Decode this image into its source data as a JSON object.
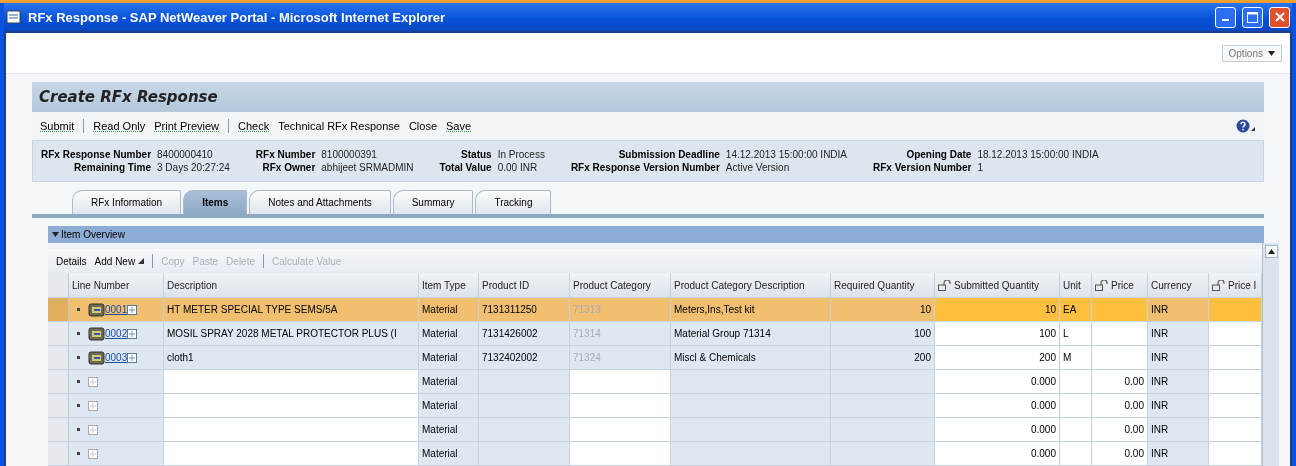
{
  "window": {
    "title": "RFx Response - SAP NetWeaver Portal - Microsoft Internet Explorer"
  },
  "options_button": {
    "label": "Options"
  },
  "page": {
    "title": "Create RFx Response"
  },
  "toolbar": [
    {
      "kind": "link",
      "label": "Submit"
    },
    {
      "kind": "separator"
    },
    {
      "kind": "link",
      "label": "Read Only"
    },
    {
      "kind": "link",
      "label": "Print Preview"
    },
    {
      "kind": "separator"
    },
    {
      "kind": "link",
      "label": "Check"
    },
    {
      "kind": "plain",
      "label": "Technical RFx Response"
    },
    {
      "kind": "plain",
      "label": "Close"
    },
    {
      "kind": "link",
      "label": "Save"
    }
  ],
  "info": [
    [
      {
        "label": "RFx Response Number",
        "value": "8400000410"
      },
      {
        "label": "RFx Number",
        "value": "8100000391"
      },
      {
        "label": "Status",
        "value": "In Process"
      },
      {
        "label": "Submission Deadline",
        "value": "14.12.2013 15:00:00 INDIA"
      },
      {
        "label": "Opening Date",
        "value": "18.12.2013 15:00:00 INDIA"
      }
    ],
    [
      {
        "label": "Remaining Time",
        "value": "3 Days 20:27:24"
      },
      {
        "label": "RFx Owner",
        "value": "abhijeet SRMADMIN"
      },
      {
        "label": "Total Value",
        "value": "0.00 INR"
      },
      {
        "label": "RFx Response Version Number",
        "value": "Active Version"
      },
      {
        "label": "RFx Version Number",
        "value": "1"
      }
    ]
  ],
  "tabs": [
    {
      "label": "RFx Information",
      "selected": false
    },
    {
      "label": "Items",
      "selected": true
    },
    {
      "label": "Notes and Attachments",
      "selected": false
    },
    {
      "label": "Summary",
      "selected": false
    },
    {
      "label": "Tracking",
      "selected": false
    }
  ],
  "section": {
    "title": "Item Overview",
    "expanded": true
  },
  "table_toolbar": [
    {
      "kind": "button",
      "label": "Details",
      "disabled": false
    },
    {
      "kind": "menu",
      "label": "Add New",
      "disabled": false
    },
    {
      "kind": "separator"
    },
    {
      "kind": "button",
      "label": "Copy",
      "disabled": true
    },
    {
      "kind": "button",
      "label": "Paste",
      "disabled": true
    },
    {
      "kind": "button",
      "label": "Delete",
      "disabled": true
    },
    {
      "kind": "separator"
    },
    {
      "kind": "button",
      "label": "Calculate Value",
      "disabled": true
    }
  ],
  "table": {
    "columns": [
      {
        "label": "Line Number",
        "locked": false
      },
      {
        "label": "Description",
        "locked": false
      },
      {
        "label": "Item Type",
        "locked": false
      },
      {
        "label": "Product ID",
        "locked": false
      },
      {
        "label": "Product Category",
        "locked": false
      },
      {
        "label": "Product Category Description",
        "locked": false
      },
      {
        "label": "Required Quantity",
        "locked": false
      },
      {
        "label": "Submitted Quantity",
        "locked": true
      },
      {
        "label": "Unit",
        "locked": false
      },
      {
        "label": "Price",
        "locked": true
      },
      {
        "label": "Currency",
        "locked": false
      },
      {
        "label": "Price I",
        "locked": true
      }
    ],
    "rows": [
      {
        "kind": "item",
        "selected": true,
        "cells": [
          "0001",
          "HT METER SPECIAL TYPE SEMS/5A",
          "Material",
          "7131311250",
          "71313",
          "Meters,Ins,Test kit",
          "10",
          "10",
          "EA",
          "",
          "INR",
          ""
        ]
      },
      {
        "kind": "item",
        "selected": false,
        "cells": [
          "0002",
          "MOSIL SPRAY 2028 METAL PROTECTOR PLUS (I",
          "Material",
          "7131426002",
          "71314",
          "Material Group 71314",
          "100",
          "100",
          "L",
          "",
          "INR",
          ""
        ]
      },
      {
        "kind": "item",
        "selected": false,
        "cells": [
          "0003",
          "cloth1",
          "Material",
          "7132402002",
          "71324",
          "Miscl & Chemicals",
          "200",
          "200",
          "M",
          "",
          "INR",
          ""
        ]
      },
      {
        "kind": "blank",
        "selected": false,
        "cells": [
          "",
          "",
          "Material",
          "",
          "",
          "",
          "",
          "0.000",
          "",
          "0.00",
          "INR",
          ""
        ]
      },
      {
        "kind": "blank",
        "selected": false,
        "cells": [
          "",
          "",
          "Material",
          "",
          "",
          "",
          "",
          "0.000",
          "",
          "0.00",
          "INR",
          ""
        ]
      },
      {
        "kind": "blank",
        "selected": false,
        "cells": [
          "",
          "",
          "Material",
          "",
          "",
          "",
          "",
          "0.000",
          "",
          "0.00",
          "INR",
          ""
        ]
      },
      {
        "kind": "blank",
        "selected": false,
        "cells": [
          "",
          "",
          "Material",
          "",
          "",
          "",
          "",
          "0.000",
          "",
          "0.00",
          "INR",
          ""
        ]
      }
    ]
  }
}
